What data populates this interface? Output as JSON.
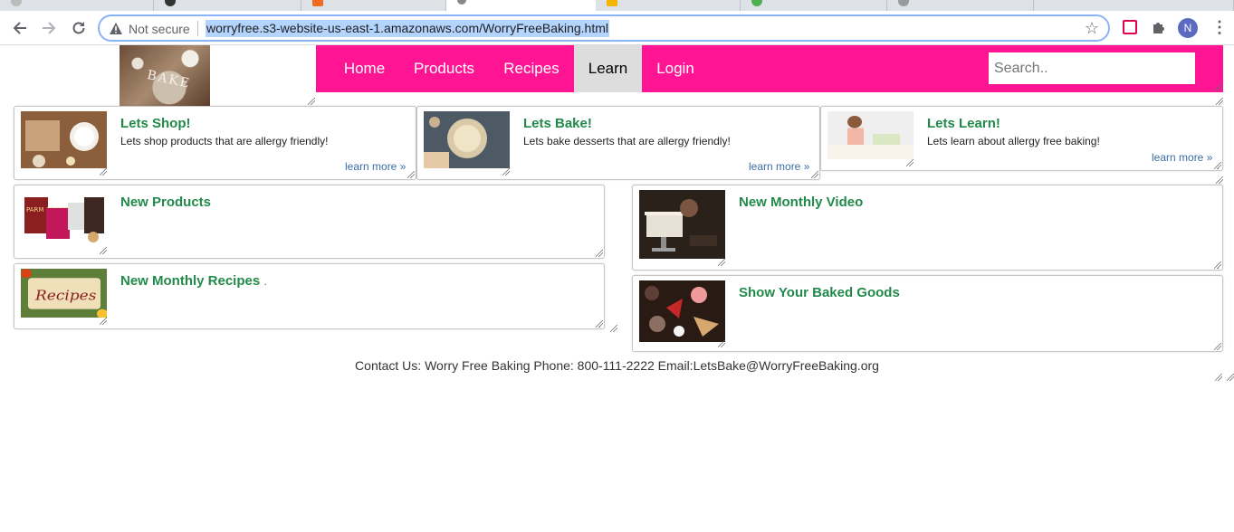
{
  "browser": {
    "not_secure_label": "Not secure",
    "url": "worryfree.s3-website-us-east-1.amazonaws.com/WorryFreeBaking.html",
    "profile_initial": "N"
  },
  "site": {
    "logo_text": "BAKE",
    "nav": {
      "home": "Home",
      "products": "Products",
      "recipes": "Recipes",
      "learn": "Learn",
      "login": "Login"
    },
    "search_placeholder": "Search..",
    "top_cards": [
      {
        "title": "Lets Shop!",
        "description": "Lets shop products that are allergy friendly!",
        "more": "learn more »"
      },
      {
        "title": "Lets Bake!",
        "description": "Lets bake desserts that are allergy friendly!",
        "more": "learn more »"
      },
      {
        "title": "Lets Learn!",
        "description": "Lets learn about allergy free baking!",
        "more": "learn more »"
      }
    ],
    "new_products": {
      "title": "New Products"
    },
    "new_recipes": {
      "title": "New Monthly Recipes",
      "suffix": "."
    },
    "new_video": {
      "title": "New Monthly Video"
    },
    "show_goods": {
      "title": "Show Your Baked Goods"
    },
    "recipes_thumb_text": "Recipes",
    "products_thumb_text": "PARM CRISPS",
    "footer": "Contact Us: Worry Free Baking Phone: 800-111-2222 Email:LetsBake@WorryFreeBaking.org",
    "colors": {
      "navbar": "#ff1493",
      "active_tab": "#dddddd",
      "card_title": "#218a4a",
      "link": "#3a6ea5"
    }
  }
}
